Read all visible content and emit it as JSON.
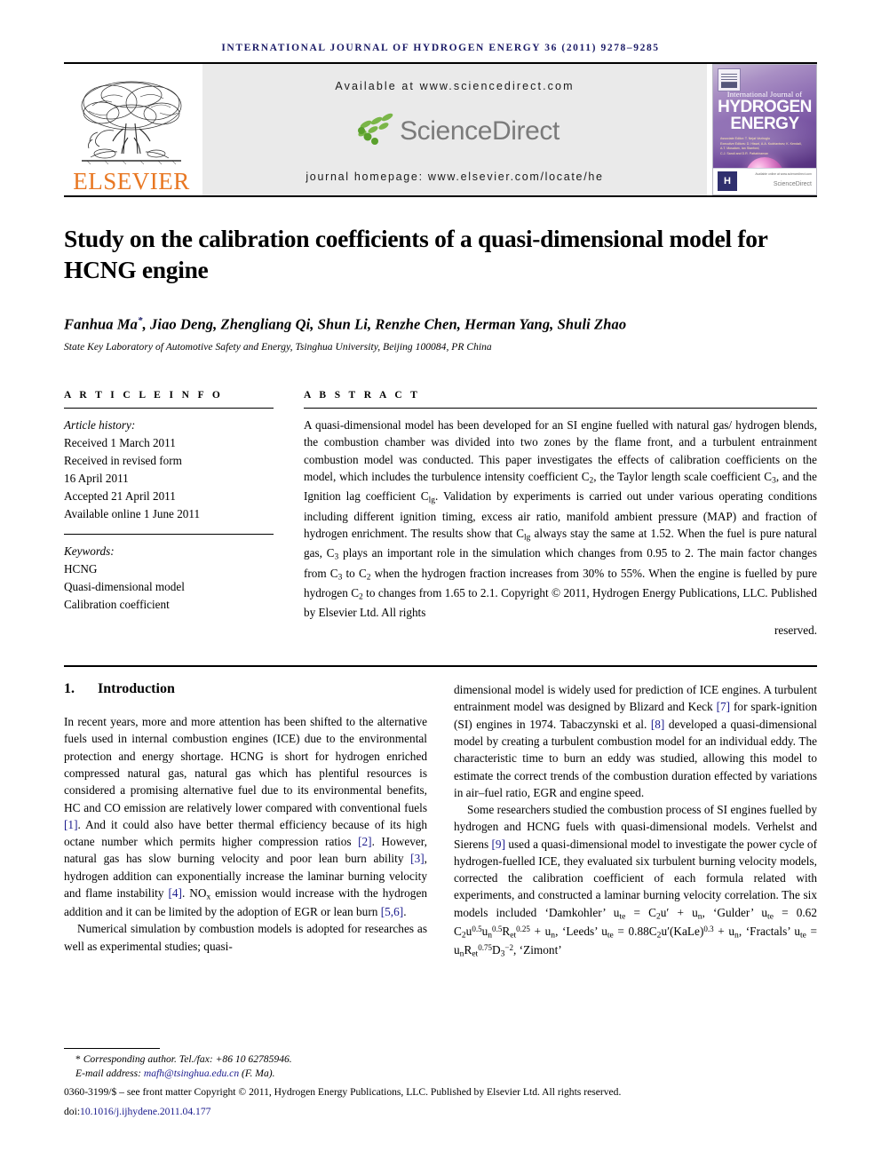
{
  "running_head": "INTERNATIONAL JOURNAL OF HYDROGEN ENERGY 36 (2011) 9278–9285",
  "masthead": {
    "publisher_logo_text": "ELSEVIER",
    "available_at": "Available at www.sciencedirect.com",
    "sciencedirect_word": "ScienceDirect",
    "journal_homepage": "journal homepage: www.elsevier.com/locate/he",
    "cover": {
      "line1": "International Journal of",
      "line2": "HYDROGEN",
      "line3": "ENERGY",
      "editors_line1": "Associate Editor:   T. Nejat Veziroglu",
      "editors_line2": "Executive Editors:  D. Hissel, A.A. Kudriavtsev, K. Kendall,",
      "editors_line3": "A.T. Mosalam, Ian Stanford,",
      "editors_line4": "C.J. Sandi and D.R. Pattabiraman",
      "badge": "H",
      "sd_mark": "ScienceDirect",
      "sd_small": "Available online at www.sciencedirect.com"
    }
  },
  "article": {
    "title": "Study on the calibration coefficients of a quasi-dimensional model for HCNG engine",
    "authors_prefix": "Fanhua Ma",
    "authors_star": "*",
    "authors_rest": ", Jiao Deng, Zhengliang Qi, Shun Li, Renzhe Chen, Herman Yang, Shuli Zhao",
    "affiliation": "State Key Laboratory of Automotive Safety and Energy, Tsinghua University, Beijing 100084, PR China"
  },
  "article_info": {
    "heading": "A R T I C L E   I N F O",
    "history_label": "Article history:",
    "history": [
      "Received 1 March 2011",
      "Received in revised form",
      "16 April 2011",
      "Accepted 21 April 2011",
      "Available online 1 June 2011"
    ],
    "keywords_label": "Keywords:",
    "keywords": [
      "HCNG",
      "Quasi-dimensional model",
      "Calibration coefficient"
    ]
  },
  "abstract": {
    "heading": "A B S T R A C T",
    "part1": "A quasi-dimensional model has been developed for an SI engine fuelled with natural gas/ hydrogen blends, the combustion chamber was divided into two zones by the flame front, and a turbulent entrainment combustion model was conducted. This paper investigates the effects of calibration coefficients on the model, which includes the turbulence intensity coefficient C",
    "sub1": "2",
    "part2": ", the Taylor length scale coefficient C",
    "sub2": "3",
    "part3": ", and the Ignition lag coefficient C",
    "sub3": "lg",
    "part4": ". Validation by experiments is carried out under various operating conditions including different ignition timing, excess air ratio, manifold ambient pressure (MAP) and fraction of hydrogen enrichment. The results show that C",
    "sub4": "lg",
    "part5": " always stay the same at 1.52. When the fuel is pure natural gas, C",
    "sub5": "3",
    "part6": " plays an important role in the simulation which changes from 0.95 to 2. The main factor changes from C",
    "sub6": "3",
    "part7": " to C",
    "sub7": "2",
    "part8": " when the hydrogen fraction increases from 30% to 55%. When the engine is fuelled by pure hydrogen C",
    "sub8": "2",
    "part9": " to changes from 1.65 to 2.1.",
    "copyright": "Copyright © 2011, Hydrogen Energy Publications, LLC. Published by Elsevier Ltd. All rights",
    "copyright_last": "reserved."
  },
  "introduction": {
    "number": "1.",
    "heading": "Introduction",
    "left": {
      "p1_a": "In recent years, more and more attention has been shifted to the alternative fuels used in internal combustion engines (ICE) due to the environmental protection and energy shortage. HCNG is short for hydrogen enriched compressed natural gas, natural gas which has plentiful resources is considered a promising alternative fuel due to its environmental benefits, HC and CO emission are relatively lower compared with conventional fuels ",
      "r1": "[1]",
      "p1_b": ". And it could also have better thermal efficiency because of its high octane number which permits higher compression ratios ",
      "r2": "[2]",
      "p1_c": ". However, natural gas has slow burning velocity and poor lean burn ability ",
      "r3": "[3]",
      "p1_d": ", hydrogen addition can exponentially increase the laminar burning velocity and flame instability ",
      "r4": "[4]",
      "p1_e": ". NO",
      "p1_sub": "x",
      "p1_f": " emission would increase with the hydrogen addition and it can be limited by the adoption of EGR or lean burn ",
      "r5": "[5,6]",
      "p1_g": ".",
      "p2": "Numerical simulation by combustion models is adopted for researches as well as experimental studies; quasi-"
    },
    "right": {
      "p1_a": "dimensional model is widely used for prediction of ICE engines. A turbulent entrainment model was designed by Blizard and Keck ",
      "r7": "[7]",
      "p1_b": " for spark-ignition (SI) engines in 1974. Tabaczynski et al. ",
      "r8": "[8]",
      "p1_c": " developed a quasi-dimensional model by creating a turbulent combustion model for an individual eddy. The characteristic time to burn an eddy was studied, allowing this model to estimate the correct trends of the combustion duration effected by variations in air–fuel ratio, EGR and engine speed.",
      "p2_a": "Some researchers studied the combustion process of SI engines fuelled by hydrogen and HCNG fuels with quasi-dimensional models. Verhelst and Sierens ",
      "r9": "[9]",
      "p2_b": " used a quasi-dimensional model to investigate the power cycle of hydrogen-fuelled ICE, they evaluated six turbulent burning velocity models, corrected the calibration coefficient of each formula related with experiments, and constructed a laminar burning velocity correlation. The six models included ‘Damkohler’ ",
      "f1": "u_te = C_2 u' + u_n",
      "f1_mid": ", ‘Gulder’ ",
      "f2": "u_te = 0.62 C_2 u^0.5 u_n^0.5 R_et^0.25 + u_n",
      "f2_mid": ", ‘Leeds’ ",
      "f3": "u_te = 0.88 C_2 u'(KaLe)^0.3 + u_n",
      "f3_mid": ", ‘Fractals’ ",
      "f4": "u_te = u_n R_et^0.75 D_3^-2",
      "f4_end": ", ‘Zimont’"
    }
  },
  "footnotes": {
    "corresponding_star": "*",
    "corresponding": " Corresponding author. Tel./fax: +86 10 62785946.",
    "email_label": "E-mail address: ",
    "email": "mafh@tsinghua.edu.cn",
    "email_suffix": " (F. Ma).",
    "issn_line": "0360-3199/$ – see front matter Copyright © 2011, Hydrogen Energy Publications, LLC. Published by Elsevier Ltd. All rights reserved.",
    "doi_label": "doi:",
    "doi": "10.1016/j.ijhydene.2011.04.177"
  },
  "colors": {
    "runhead": "#1a1a66",
    "elsevier_orange": "#E87722",
    "link_blue": "#1a1a8c",
    "band_gray": "#eaeaea"
  }
}
